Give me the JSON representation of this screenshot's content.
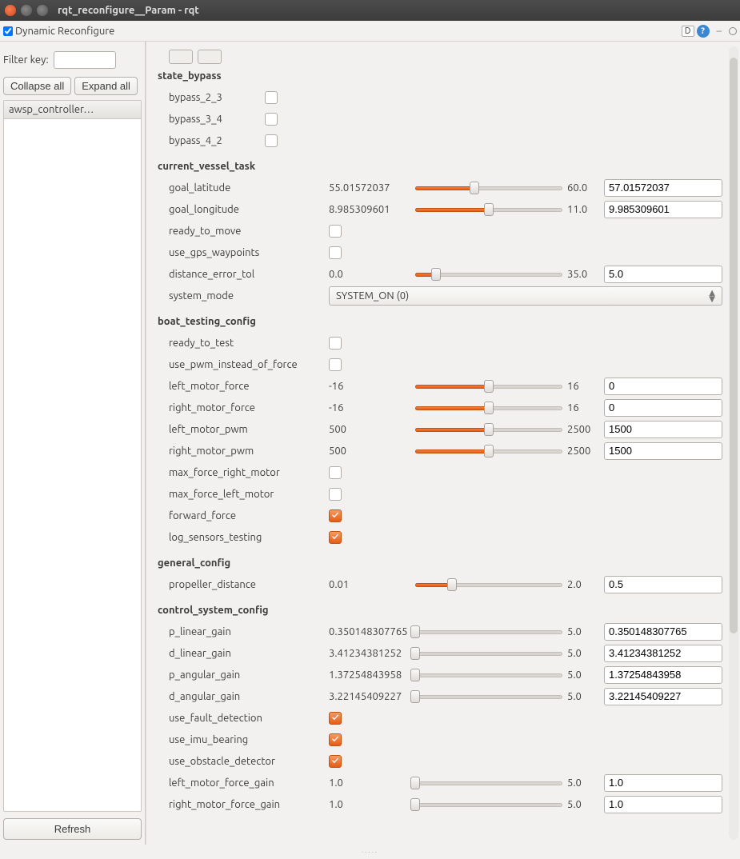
{
  "window": {
    "title": "rqt_reconfigure__Param - rqt"
  },
  "menubar": {
    "tab_label": "Dynamic Reconfigure",
    "d_badge": "D",
    "help": "?"
  },
  "sidebar": {
    "filter_label": "Filter key:",
    "filter_value": "",
    "collapse": "Collapse all",
    "expand": "Expand all",
    "tree_item": "awsp_controller…",
    "refresh": "Refresh"
  },
  "groups": [
    {
      "title": "state_bypass",
      "params": [
        {
          "name": "bypass_2_3",
          "type": "bool",
          "checked": false,
          "tight": true
        },
        {
          "name": "bypass_3_4",
          "type": "bool",
          "checked": false,
          "tight": true
        },
        {
          "name": "bypass_4_2",
          "type": "bool",
          "checked": false,
          "tight": true
        }
      ]
    },
    {
      "title": "current_vessel_task",
      "params": [
        {
          "name": "goal_latitude",
          "type": "slider",
          "min": "55.01572037",
          "max": "60.0",
          "value": "57.01572037",
          "pct": 40
        },
        {
          "name": "goal_longitude",
          "type": "slider",
          "min": "8.985309601",
          "max": "11.0",
          "value": "9.985309601",
          "pct": 50
        },
        {
          "name": "ready_to_move",
          "type": "bool",
          "checked": false
        },
        {
          "name": "use_gps_waypoints",
          "type": "bool",
          "checked": false
        },
        {
          "name": "distance_error_tol",
          "type": "slider",
          "min": "0.0",
          "max": "35.0",
          "value": "5.0",
          "pct": 14
        },
        {
          "name": "system_mode",
          "type": "enum",
          "value": "SYSTEM_ON (0)"
        }
      ]
    },
    {
      "title": "boat_testing_config",
      "params": [
        {
          "name": "ready_to_test",
          "type": "bool",
          "checked": false
        },
        {
          "name": "use_pwm_instead_of_force",
          "type": "bool",
          "checked": false
        },
        {
          "name": "left_motor_force",
          "type": "slider",
          "min": "-16",
          "max": "16",
          "value": "0",
          "pct": 50
        },
        {
          "name": "right_motor_force",
          "type": "slider",
          "min": "-16",
          "max": "16",
          "value": "0",
          "pct": 50
        },
        {
          "name": "left_motor_pwm",
          "type": "slider",
          "min": "500",
          "max": "2500",
          "value": "1500",
          "pct": 50
        },
        {
          "name": "right_motor_pwm",
          "type": "slider",
          "min": "500",
          "max": "2500",
          "value": "1500",
          "pct": 50
        },
        {
          "name": "max_force_right_motor",
          "type": "bool",
          "checked": false
        },
        {
          "name": "max_force_left_motor",
          "type": "bool",
          "checked": false
        },
        {
          "name": "forward_force",
          "type": "bool",
          "checked": true
        },
        {
          "name": "log_sensors_testing",
          "type": "bool",
          "checked": true
        }
      ]
    },
    {
      "title": "general_config",
      "params": [
        {
          "name": "propeller_distance",
          "type": "slider",
          "min": "0.01",
          "max": "2.0",
          "value": "0.5",
          "pct": 25
        }
      ]
    },
    {
      "title": "control_system_config",
      "params": [
        {
          "name": "p_linear_gain",
          "type": "slider",
          "min": "0.350148307765",
          "max": "5.0",
          "value": "0.350148307765",
          "pct": 0
        },
        {
          "name": "d_linear_gain",
          "type": "slider",
          "min": "3.41234381252",
          "max": "5.0",
          "value": "3.41234381252",
          "pct": 0
        },
        {
          "name": "p_angular_gain",
          "type": "slider",
          "min": "1.37254843958",
          "max": "5.0",
          "value": "1.37254843958",
          "pct": 0
        },
        {
          "name": "d_angular_gain",
          "type": "slider",
          "min": "3.22145409227",
          "max": "5.0",
          "value": "3.22145409227",
          "pct": 0
        },
        {
          "name": "use_fault_detection",
          "type": "bool",
          "checked": true
        },
        {
          "name": "use_imu_bearing",
          "type": "bool",
          "checked": true
        },
        {
          "name": "use_obstacle_detector",
          "type": "bool",
          "checked": true
        },
        {
          "name": "left_motor_force_gain",
          "type": "slider",
          "min": "1.0",
          "max": "5.0",
          "value": "1.0",
          "pct": 0
        },
        {
          "name": "right_motor_force_gain",
          "type": "slider",
          "min": "1.0",
          "max": "5.0",
          "value": "1.0",
          "pct": 0
        }
      ]
    }
  ]
}
